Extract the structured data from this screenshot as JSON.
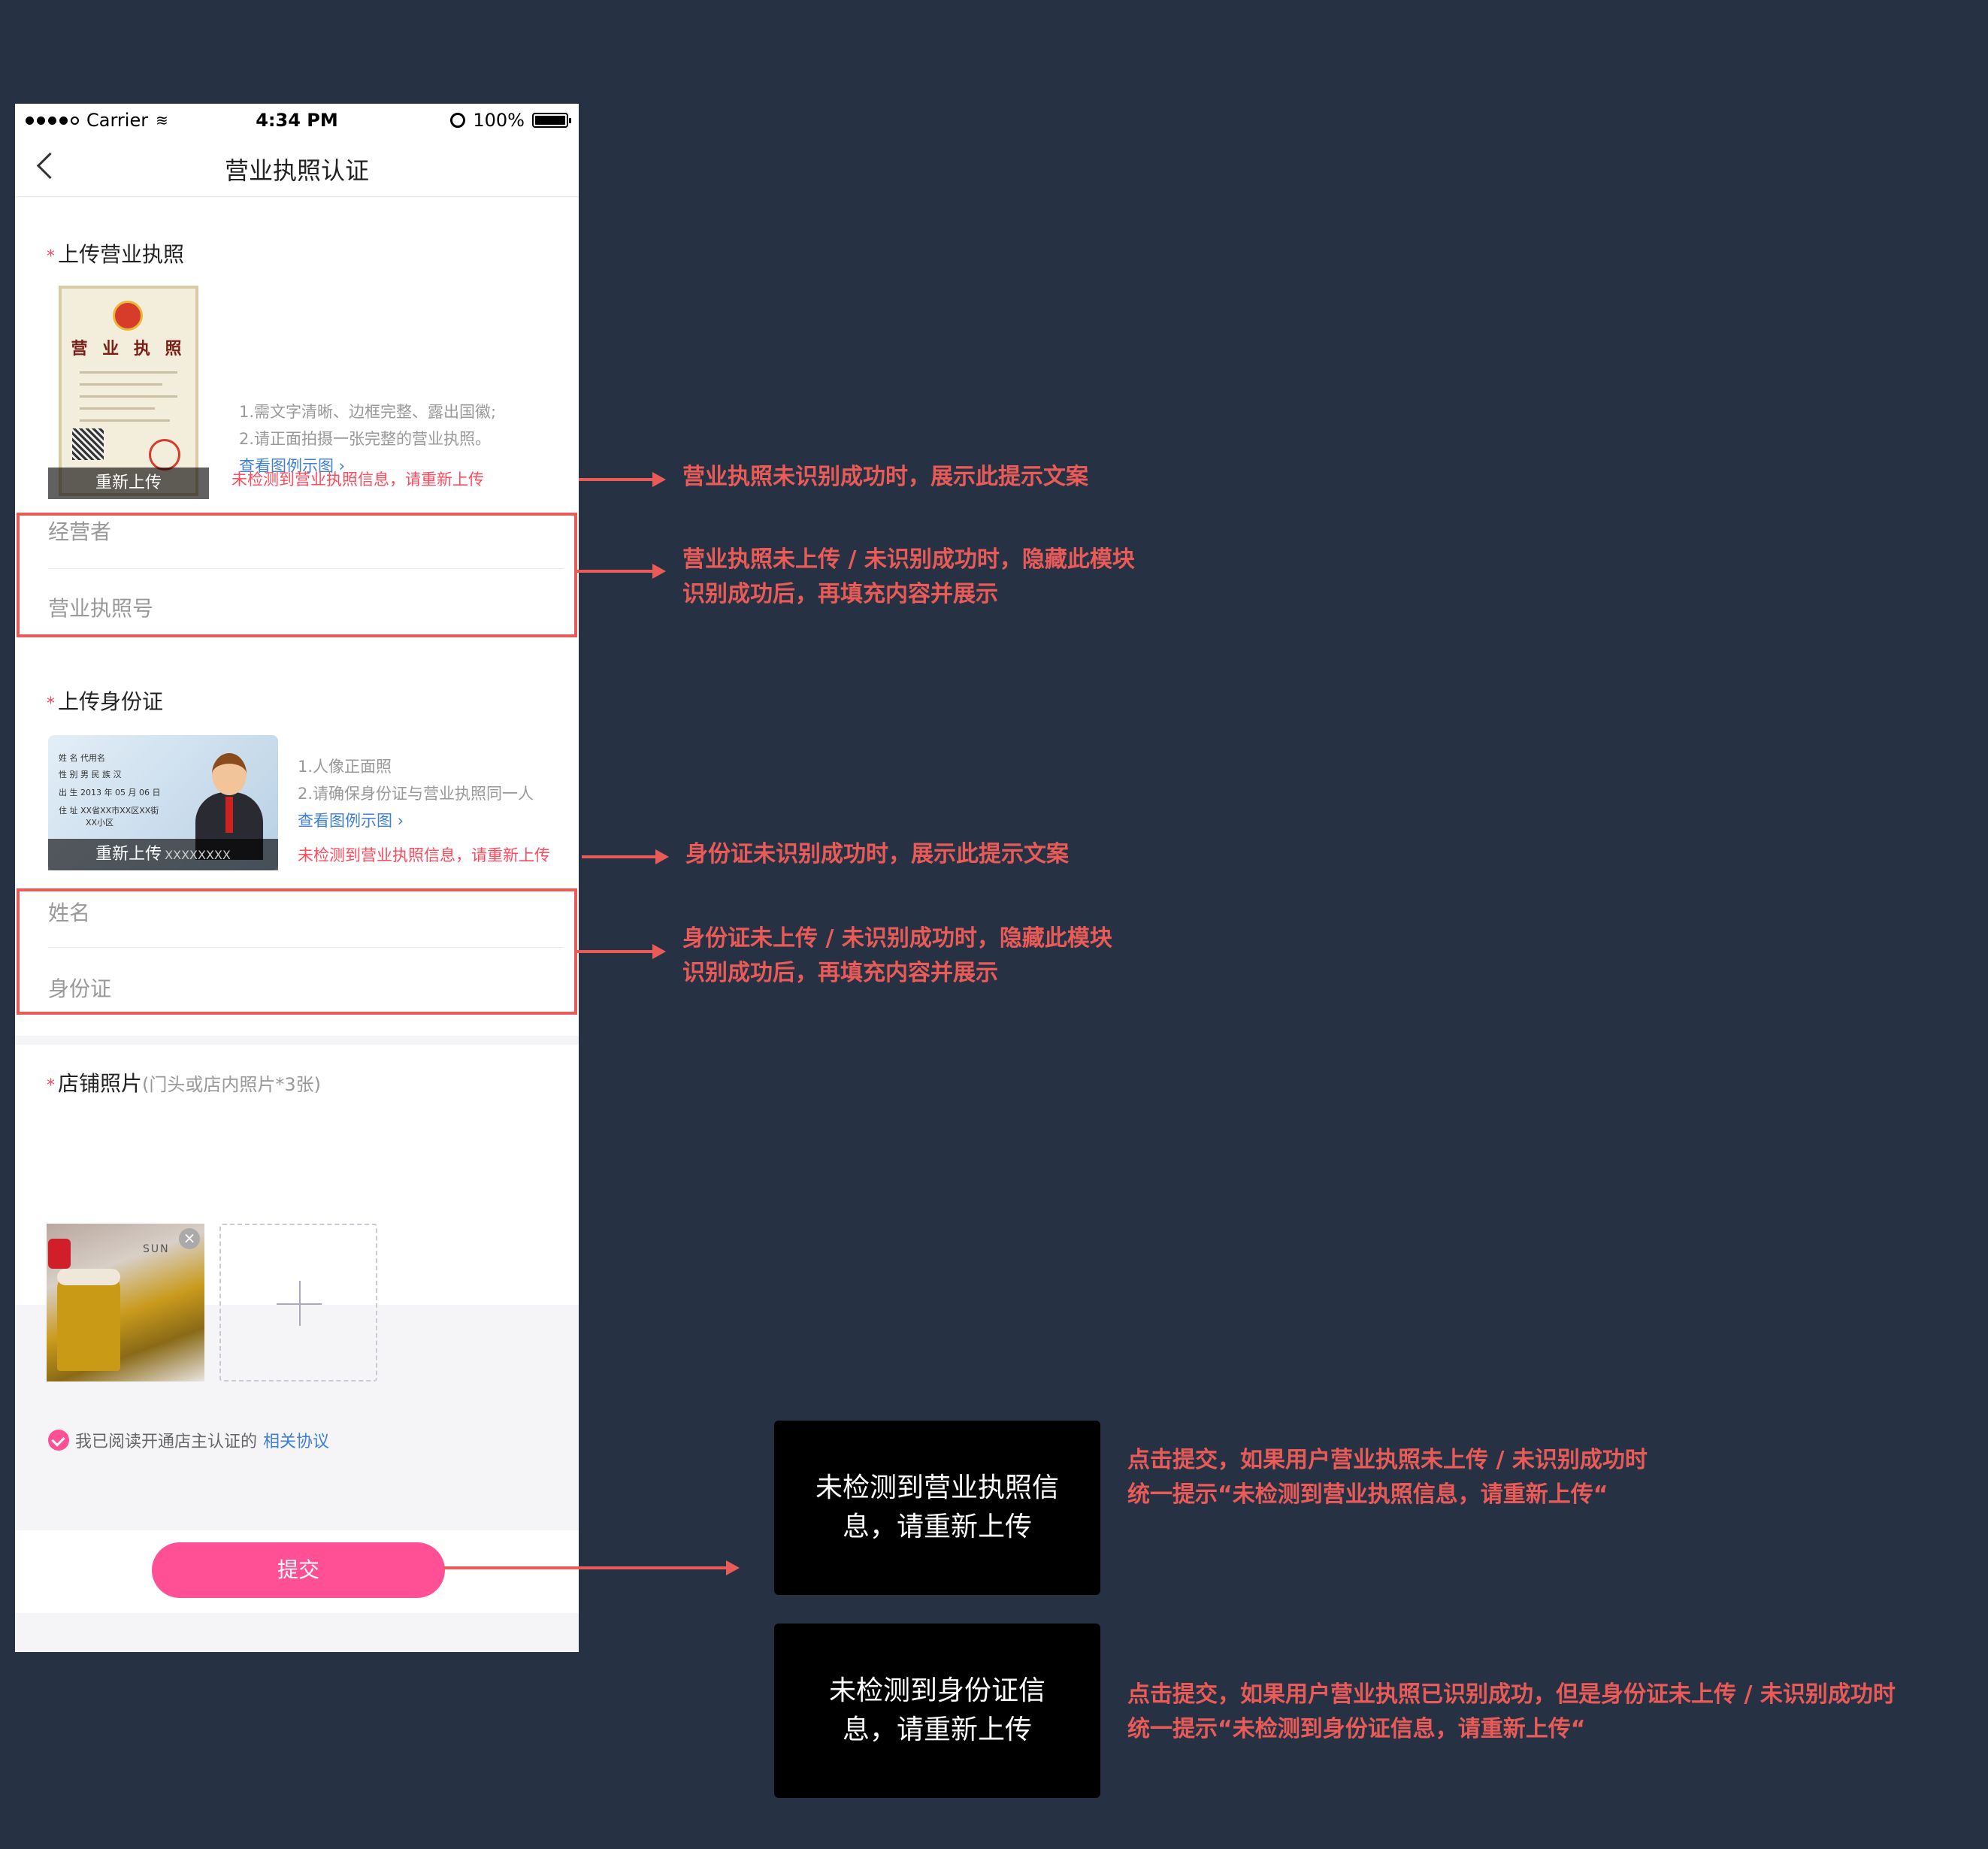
{
  "status_bar": {
    "carrier": "Carrier",
    "time": "4:34 PM",
    "battery": "100%"
  },
  "nav": {
    "title": "营业执照认证"
  },
  "license": {
    "title": "上传营业执照",
    "image_title": "营 业 执 照",
    "tip1": "1.需文字清晰、边框完整、露出国徽;",
    "tip2": "2.请正面拍摄一张完整的营业执照。",
    "link": "查看图例示图 ›",
    "reupload": "重新上传",
    "error": "未检测到营业执照信息，请重新上传",
    "field_operator": "经营者",
    "field_number": "营业执照号"
  },
  "idcard": {
    "title": "上传身份证",
    "card_name": "姓 名   代用名",
    "card_sex": "性 别   男    民 族  汉",
    "card_birth": "出 生   2013  年  05  月  06  日",
    "card_addr": "住 址   XX省XX市XX区XX街",
    "card_addr2": "XX小区",
    "tip1": "1.人像正面照",
    "tip2": "2.请确保身份证与营业执照同一人",
    "link": "查看图例示图 ›",
    "reupload": "重新上传",
    "card_number": "XXXXXXXX",
    "error": "未检测到营业执照信息，请重新上传",
    "field_name": "姓名",
    "field_id": "身份证"
  },
  "store": {
    "title": "店铺照片",
    "hint": "(门头或店内照片*3张)",
    "sign": "SUN"
  },
  "agreement": {
    "text": "我已阅读开通店主认证的",
    "link": "相关协议"
  },
  "submit": {
    "label": "提交"
  },
  "annotations": {
    "note1": "营业执照未识别成功时，展示此提示文案",
    "note2a": "营业执照未上传 / 未识别成功时，隐藏此模块",
    "note2b": "识别成功后，再填充内容并展示",
    "note3": "身份证未识别成功时，展示此提示文案",
    "note4a": "身份证未上传 / 未识别成功时，隐藏此模块",
    "note4b": "识别成功后，再填充内容并展示",
    "toast1": "未检测到营业执照信息，请重新上传",
    "toast1_note_a": "点击提交，如果用户营业执照未上传 / 未识别成功时",
    "toast1_note_b": "统一提示“未检测到营业执照信息，请重新上传“",
    "toast2": "未检测到身份证信息，请重新上传",
    "toast2_note_a": "点击提交，如果用户营业执照已识别成功，但是身份证未上传 / 未识别成功时",
    "toast2_note_b": "统一提示“未检测到身份证信息，请重新上传“"
  },
  "colors": {
    "accent": "#ff4f95",
    "error": "#ff4a5c",
    "annotation": "#ea5b57",
    "link": "#3f7fd6",
    "background": "#263244"
  }
}
